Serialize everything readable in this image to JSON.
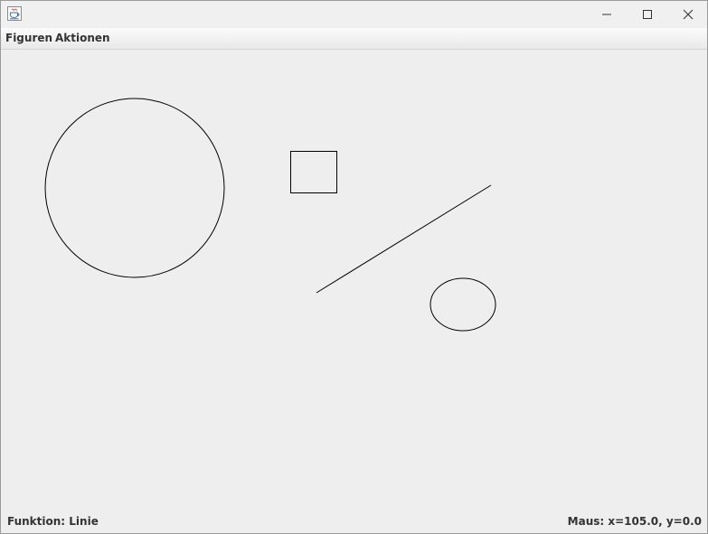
{
  "menubar": {
    "items": [
      {
        "label": "Figuren"
      },
      {
        "label": "Aktionen"
      }
    ]
  },
  "canvas": {
    "shapes": [
      {
        "type": "circle"
      },
      {
        "type": "rectangle"
      },
      {
        "type": "line"
      },
      {
        "type": "ellipse"
      }
    ]
  },
  "status": {
    "function_text": "Funktion: Linie",
    "mouse_text": "Maus: x=105.0, y=0.0"
  },
  "icons": {
    "app": "java-coffee-cup-icon",
    "minimize": "minimize-icon",
    "maximize": "maximize-icon",
    "close": "close-icon"
  }
}
